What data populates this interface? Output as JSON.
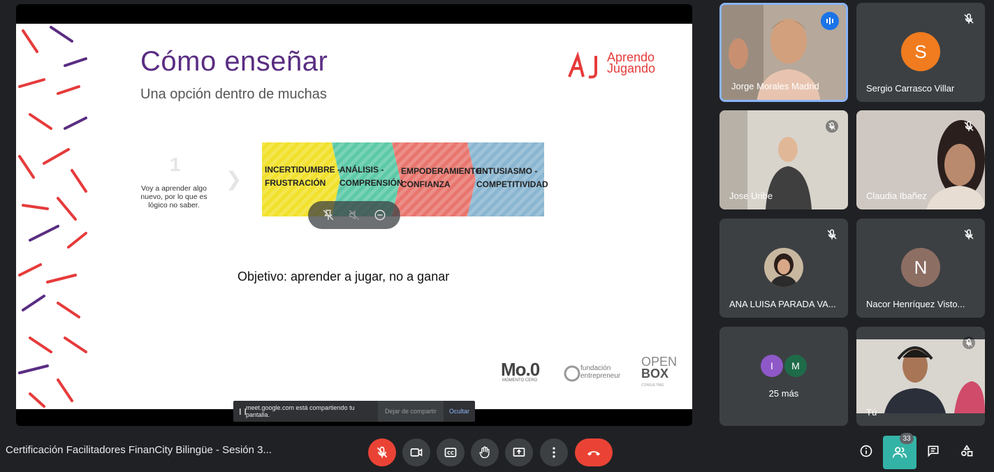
{
  "slide": {
    "title": "Cómo enseñar",
    "subtitle": "Una opción dentro de muchas",
    "brand_line1": "Aprendo",
    "brand_line2": "Jugando",
    "step_number": "1",
    "step_text": "Voy a aprender algo nuevo, por lo que es lógico no saber.",
    "stages": [
      {
        "line1": "INCERTIDUMBRE -",
        "line2": "FRUSTRACIÓN",
        "color": "#f2e12b"
      },
      {
        "line1": "ANÁLISIS -",
        "line2": "COMPRENSIÓN",
        "color": "#5cc9a7"
      },
      {
        "line1": "EMPODERAMIENTO -",
        "line2": "CONFIANZA",
        "color": "#e8766e"
      },
      {
        "line1": "ENTUSIASMO -",
        "line2": "COMPETITIVIDAD",
        "color": "#8ab6d1"
      }
    ],
    "objective": "Objetivo: aprender a jugar, no a ganar",
    "sponsor_moo": "Mo.0",
    "sponsor_moo_sub": "MOMENTO CERO",
    "sponsor_fund": "fundación",
    "sponsor_fund2": "entrepreneur",
    "sponsor_open": "OPEN",
    "sponsor_box": "BOX",
    "sponsor_box_sub": "CONSULTING"
  },
  "share_banner": {
    "message": "meet.google.com está compartiendo tu pantalla.",
    "stop_label": "Dejar de compartir",
    "hide_label": "Ocultar"
  },
  "participants": [
    {
      "name": "Jorge Morales Madrid",
      "type": "video",
      "speaking": true
    },
    {
      "name": "Sergio Carrasco Villar",
      "type": "avatar",
      "letter": "S",
      "color": "#f07c1f"
    },
    {
      "name": "Jose Uribe",
      "type": "video"
    },
    {
      "name": "Claudia Ibañez",
      "type": "video"
    },
    {
      "name": "ANA LUISA PARADA VA...",
      "type": "photo"
    },
    {
      "name": "Nacor Henríquez Visto...",
      "type": "avatar",
      "letter": "N",
      "color": "#8d6e63"
    },
    {
      "name": "25 más",
      "type": "more",
      "letters": [
        "I",
        "M"
      ],
      "colors": [
        "#8e58c8",
        "#1e6b4a"
      ]
    },
    {
      "name": "Tú",
      "type": "video"
    }
  ],
  "meeting": {
    "title": "Certificación Facilitadores FinanCity Bilingüe - Sesión 3...",
    "people_count": "33"
  }
}
